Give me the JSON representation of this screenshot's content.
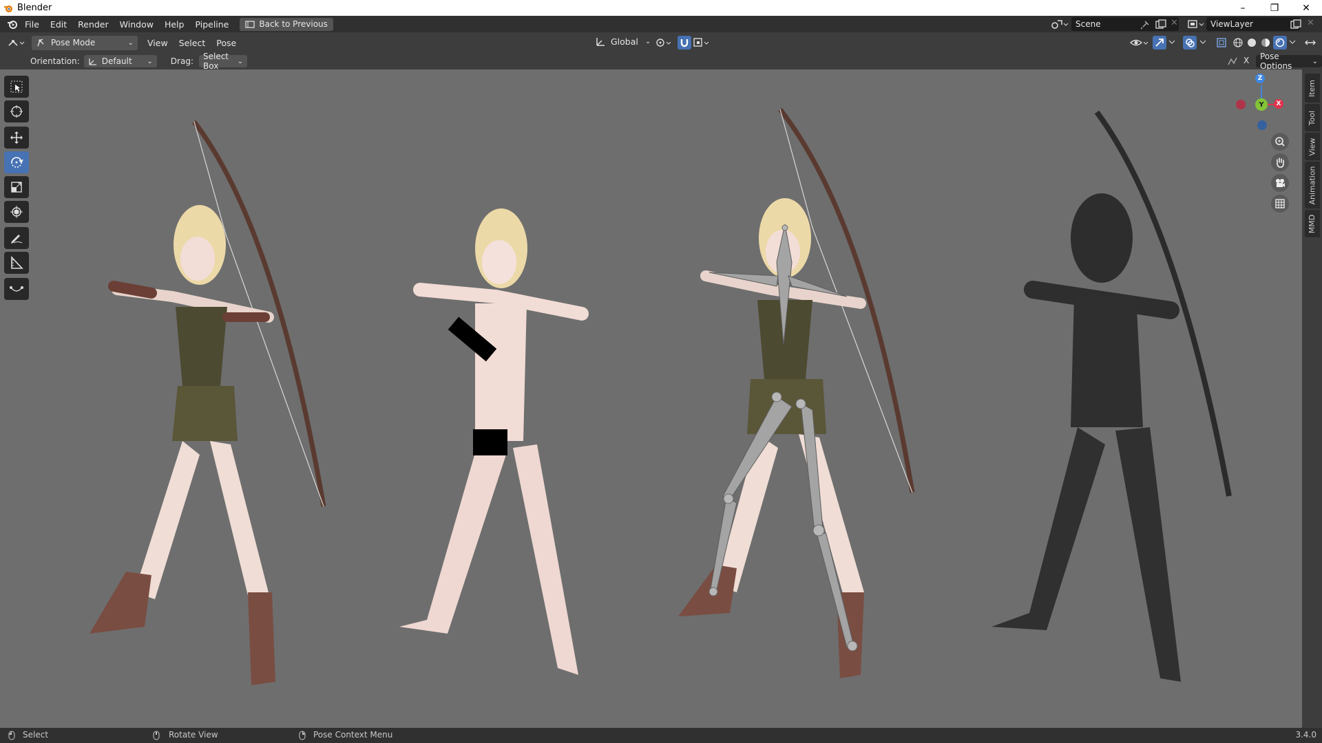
{
  "window": {
    "title": "Blender",
    "minimize": "–",
    "restore": "❐",
    "close": "✕"
  },
  "topbar": {
    "menus": [
      "File",
      "Edit",
      "Render",
      "Window",
      "Help",
      "Pipeline"
    ],
    "back_button": "Back to Previous",
    "scene": "Scene",
    "view_layer": "ViewLayer"
  },
  "header": {
    "mode": "Pose Mode",
    "menus": [
      "View",
      "Select",
      "Pose"
    ],
    "transform_orientation": "Global"
  },
  "subheader": {
    "orientation_label": "Orientation:",
    "orientation_value": "Default",
    "drag_label": "Drag:",
    "drag_value": "Select Box",
    "close_x": "X",
    "pose_options": "Pose Options"
  },
  "gizmo": {
    "z": "Z",
    "y": "Y",
    "x": "X"
  },
  "side_tabs": [
    "Item",
    "Tool",
    "View",
    "Animation",
    "MMD"
  ],
  "statusbar": {
    "select": "Select",
    "rotate": "Rotate View",
    "context": "Pose Context Menu",
    "version": "3.4.0"
  },
  "colors": {
    "viewport_bg": "#6e6e6e",
    "active_tool": "#4772b3",
    "axis_x": "#e0334f",
    "axis_y": "#82c437",
    "axis_z": "#3f86e0"
  }
}
